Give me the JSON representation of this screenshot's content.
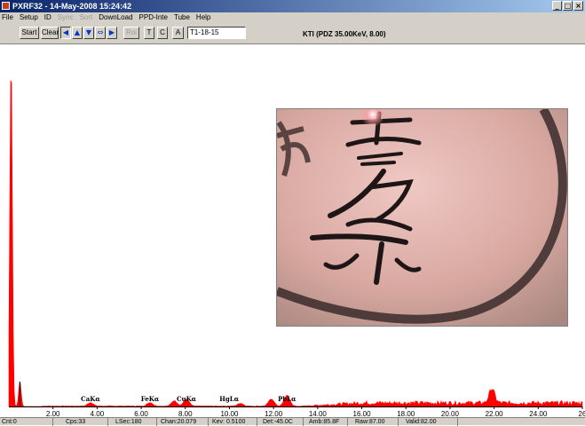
{
  "window": {
    "title": "PXRF32 - 14-May-2008 15:24:42",
    "min_glyph": "_",
    "max_glyph": "□",
    "close_glyph": "×"
  },
  "menu": {
    "items": [
      {
        "label": "File",
        "enabled": true
      },
      {
        "label": "Setup",
        "enabled": true
      },
      {
        "label": "ID",
        "enabled": true
      },
      {
        "label": "Sync",
        "enabled": false
      },
      {
        "label": "Sort",
        "enabled": false
      },
      {
        "label": "DownLoad",
        "enabled": true
      },
      {
        "label": "PPD-Inte",
        "enabled": true
      },
      {
        "label": "Tube",
        "enabled": true
      },
      {
        "label": "Help",
        "enabled": true
      }
    ]
  },
  "toolbar": {
    "start_label": "Start",
    "clear_label": "Clear",
    "roi_label": "Roi",
    "t_label": "T",
    "c_label": "C",
    "a_label": "A",
    "sample_id": "T1-18-15",
    "info": "KTI (PDZ 35.00KeV, 8.00)"
  },
  "chart_data": {
    "type": "line",
    "xlabel": "",
    "ylabel": "",
    "xlim": [
      0,
      26
    ],
    "x_ticks": [
      "2.00",
      "4.00",
      "6.00",
      "8.00",
      "10.00",
      "12.00",
      "14.00",
      "16.00",
      "18.00",
      "20.00",
      "22.00",
      "24.00",
      "26"
    ],
    "cursor_x": 0.5,
    "peak_labels": [
      {
        "label": "CaKα",
        "x": 3.7
      },
      {
        "label": "FeKα",
        "x": 6.4
      },
      {
        "label": "CuKα",
        "x": 8.05
      },
      {
        "label": "HgLα",
        "x": 9.99
      },
      {
        "label": "PbLα",
        "x": 12.61
      }
    ],
    "peaks": [
      {
        "x": 0.1,
        "height": 0.97
      },
      {
        "x": 0.5,
        "height": 0.07
      },
      {
        "x": 3.7,
        "height": 0.01
      },
      {
        "x": 6.4,
        "height": 0.01
      },
      {
        "x": 7.5,
        "height": 0.015
      },
      {
        "x": 8.05,
        "height": 0.02
      },
      {
        "x": 10.5,
        "height": 0.008
      },
      {
        "x": 11.9,
        "height": 0.02
      },
      {
        "x": 12.61,
        "height": 0.03
      },
      {
        "x": 21.9,
        "height": 0.04
      }
    ],
    "series_color": "#ff0000"
  },
  "status": {
    "cnt": "Cnt:0",
    "cps": "Cps:33",
    "lsec": "LSec:180",
    "chan": "Chan:20.079",
    "kev": "Kev: 0.5100",
    "det": "Det:-45.0C",
    "amb": "Amb:85.8F",
    "raw": "Raw:87.00",
    "valid": "Valid:82.00"
  }
}
